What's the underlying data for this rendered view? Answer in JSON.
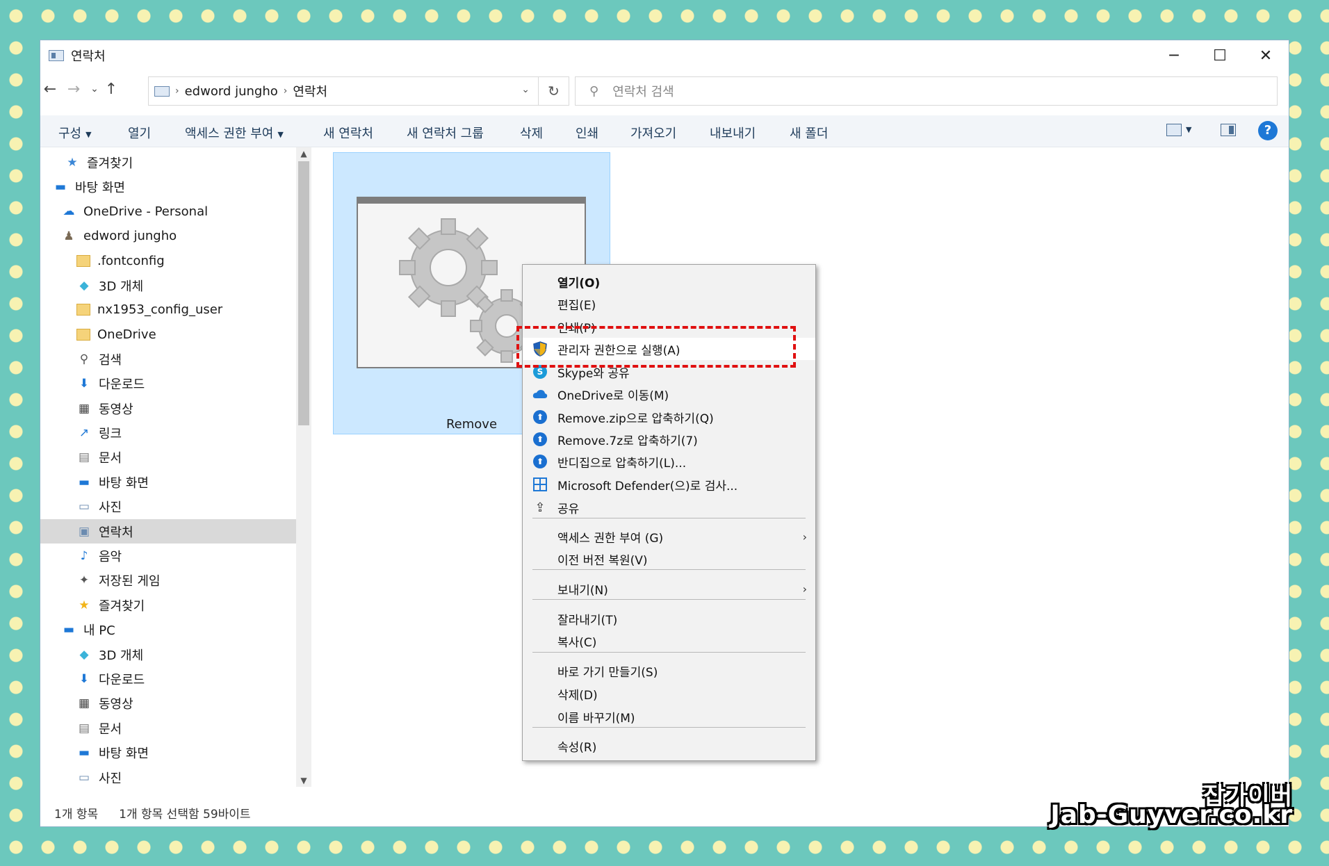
{
  "window": {
    "title": "연락처",
    "minimize_glyph": "─",
    "maximize_glyph": "☐",
    "close_glyph": "✕"
  },
  "nav": {
    "back_glyph": "←",
    "forward_glyph": "→",
    "recent_glyph": "⌄",
    "up_glyph": "↑",
    "breadcrumb": [
      "edword jungho",
      "연락처"
    ],
    "breadcrumb_sep": "›",
    "dropdown_glyph": "⌄",
    "refresh_glyph": "↻"
  },
  "search": {
    "placeholder": "연락처 검색",
    "icon_glyph": "⚲"
  },
  "toolbar": {
    "organize": "구성",
    "open": "열기",
    "grant_access": "액세스 권한 부여",
    "new_contact": "새 연락처",
    "new_contact_group": "새 연락처 그룹",
    "delete": "삭제",
    "print": "인쇄",
    "import": "가져오기",
    "export": "내보내기",
    "new_folder": "새 폴더",
    "help_glyph": "?"
  },
  "sidebar": {
    "items": [
      {
        "label": "즐겨찾기",
        "icon": "star-icon",
        "glyph": "★",
        "color": "#3a86d6"
      },
      {
        "label": "바탕 화면",
        "icon": "desktop-icon",
        "glyph": "▬",
        "color": "#1e78d6"
      },
      {
        "label": "OneDrive - Personal",
        "icon": "cloud-icon",
        "glyph": "☁",
        "color": "#1e78d6"
      },
      {
        "label": "edword jungho",
        "icon": "user-icon",
        "glyph": "♟",
        "color": "#7a6a55"
      },
      {
        "label": ".fontconfig",
        "icon": "folder-icon",
        "glyph": "",
        "color": "#f5d37a"
      },
      {
        "label": "3D 개체",
        "icon": "cube-icon",
        "glyph": "◆",
        "color": "#3bb3d9"
      },
      {
        "label": "nx1953_config_user",
        "icon": "folder-icon",
        "glyph": "",
        "color": "#f5d37a"
      },
      {
        "label": "OneDrive",
        "icon": "folder-icon",
        "glyph": "",
        "color": "#f5d37a"
      },
      {
        "label": "검색",
        "icon": "search-icon",
        "glyph": "⚲",
        "color": "#555555"
      },
      {
        "label": "다운로드",
        "icon": "download-icon",
        "glyph": "⬇",
        "color": "#1e78d6"
      },
      {
        "label": "동영상",
        "icon": "video-icon",
        "glyph": "▦",
        "color": "#444444"
      },
      {
        "label": "링크",
        "icon": "link-icon",
        "glyph": "↗",
        "color": "#1e78d6"
      },
      {
        "label": "문서",
        "icon": "document-icon",
        "glyph": "▤",
        "color": "#777777"
      },
      {
        "label": "바탕 화면",
        "icon": "desktop-icon",
        "glyph": "▬",
        "color": "#1e78d6"
      },
      {
        "label": "사진",
        "icon": "picture-icon",
        "glyph": "▭",
        "color": "#6b8bb0"
      },
      {
        "label": "연락처",
        "icon": "contacts-icon",
        "glyph": "▣",
        "color": "#6b8bb0"
      },
      {
        "label": "음악",
        "icon": "music-icon",
        "glyph": "♪",
        "color": "#1e78d6"
      },
      {
        "label": "저장된 게임",
        "icon": "games-icon",
        "glyph": "✦",
        "color": "#555555"
      },
      {
        "label": "즐겨찾기",
        "icon": "star-icon",
        "glyph": "★",
        "color": "#f2b418"
      },
      {
        "label": "내 PC",
        "icon": "pc-icon",
        "glyph": "▬",
        "color": "#1e78d6"
      },
      {
        "label": "3D 개체",
        "icon": "cube-icon",
        "glyph": "◆",
        "color": "#3bb3d9"
      },
      {
        "label": "다운로드",
        "icon": "download-icon",
        "glyph": "⬇",
        "color": "#1e78d6"
      },
      {
        "label": "동영상",
        "icon": "video-icon",
        "glyph": "▦",
        "color": "#444444"
      },
      {
        "label": "문서",
        "icon": "document-icon",
        "glyph": "▤",
        "color": "#777777"
      },
      {
        "label": "바탕 화면",
        "icon": "desktop-icon",
        "glyph": "▬",
        "color": "#1e78d6"
      },
      {
        "label": "사진",
        "icon": "picture-icon",
        "glyph": "▭",
        "color": "#6b8bb0"
      }
    ],
    "selected_label": "연락처"
  },
  "file": {
    "name": "Remove"
  },
  "status": {
    "count": "1개 항목",
    "selection": "1개 항목 선택함 59바이트"
  },
  "context_menu": {
    "items": [
      {
        "label": "열기(O)",
        "icon": "",
        "bold": true
      },
      {
        "label": "편집(E)",
        "icon": ""
      },
      {
        "label": "인쇄(P)",
        "icon": ""
      },
      {
        "label": "관리자 권한으로 실행(A)",
        "icon": "shield-icon"
      },
      {
        "label": "Skype와 공유",
        "icon": "skype-icon"
      },
      {
        "label": "OneDrive로 이동(M)",
        "icon": "onedrive-icon"
      },
      {
        "label": "Remove.zip으로 압축하기(Q)",
        "icon": "bandizip-icon"
      },
      {
        "label": "Remove.7z로 압축하기(7)",
        "icon": "bandizip-icon"
      },
      {
        "label": "반디집으로 압축하기(L)...",
        "icon": "bandizip-icon"
      },
      {
        "label": "Microsoft Defender(으)로 검사...",
        "icon": "defender-icon"
      },
      {
        "label": "공유",
        "icon": "share-icon"
      },
      {
        "label": "액세스 권한 부여 (G)",
        "icon": "",
        "submenu": true
      },
      {
        "label": "이전 버전 복원(V)",
        "icon": ""
      },
      {
        "label": "보내기(N)",
        "icon": "",
        "submenu": true
      },
      {
        "label": "잘라내기(T)",
        "icon": ""
      },
      {
        "label": "복사(C)",
        "icon": ""
      },
      {
        "label": "바로 가기 만들기(S)",
        "icon": ""
      },
      {
        "label": "삭제(D)",
        "icon": ""
      },
      {
        "label": "이름 바꾸기(M)",
        "icon": ""
      },
      {
        "label": "속성(R)",
        "icon": ""
      }
    ],
    "submenu_glyph": "›"
  },
  "watermark": {
    "line1": "잡가이버",
    "line2": "Jab-Guyver.co.kr"
  },
  "colors": {
    "selection_fill": "#cce8ff",
    "highlight_dash": "#e01010",
    "accent": "#1e78d6"
  }
}
